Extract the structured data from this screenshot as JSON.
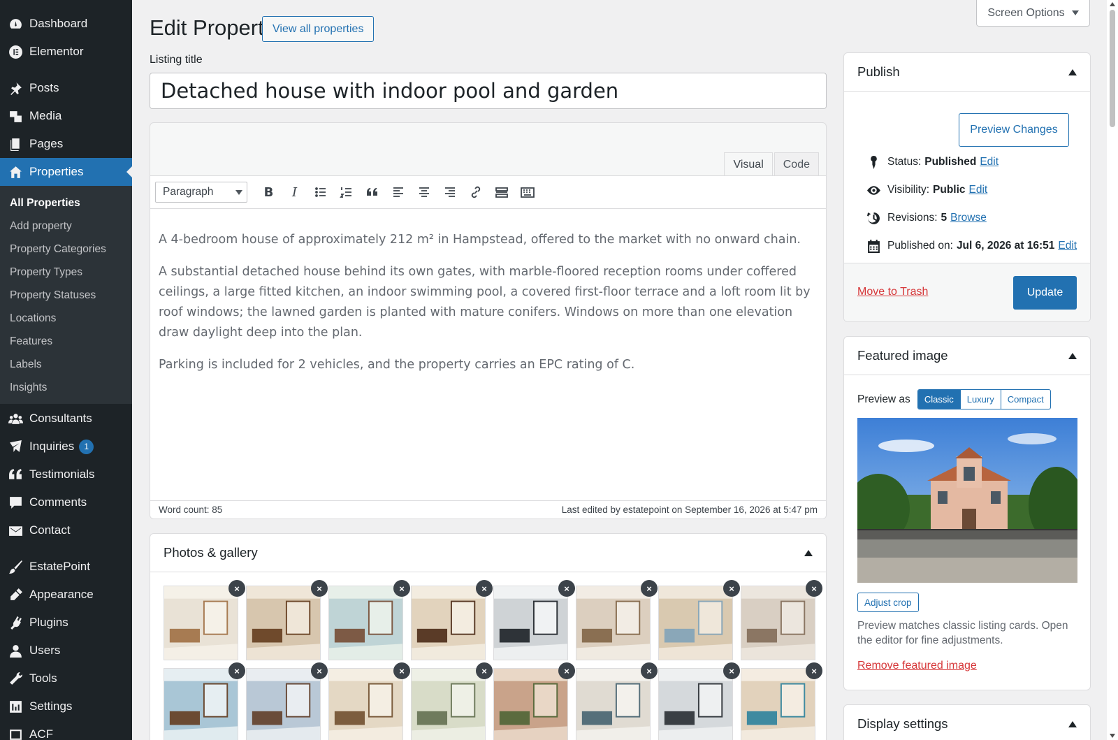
{
  "sidebar": {
    "items_top": [
      {
        "label": "Dashboard",
        "icon": "dashboard-icon"
      },
      {
        "label": "Elementor",
        "icon": "elementor-icon"
      }
    ],
    "items_content": [
      {
        "label": "Posts",
        "icon": "pin-icon"
      },
      {
        "label": "Media",
        "icon": "media-icon"
      },
      {
        "label": "Pages",
        "icon": "pages-icon"
      },
      {
        "label": "Properties",
        "icon": "home-icon"
      }
    ],
    "submenu": [
      "All Properties",
      "Add property",
      "Property Categories",
      "Property Types",
      "Property Statuses",
      "Locations",
      "Features",
      "Labels",
      "Insights"
    ],
    "items_after": [
      {
        "label": "Consultants",
        "icon": "groups-icon"
      },
      {
        "label": "Inquiries",
        "icon": "feedback-icon",
        "badge": "1"
      },
      {
        "label": "Testimonials",
        "icon": "quote-icon"
      },
      {
        "label": "Comments",
        "icon": "comments-icon"
      },
      {
        "label": "Contact",
        "icon": "email-icon"
      }
    ],
    "items_admin": [
      {
        "label": "EstatePoint",
        "icon": "brush-icon"
      },
      {
        "label": "Appearance",
        "icon": "appearance-icon"
      },
      {
        "label": "Plugins",
        "icon": "plugins-icon"
      },
      {
        "label": "Users",
        "icon": "users-icon"
      },
      {
        "label": "Tools",
        "icon": "tools-icon"
      },
      {
        "label": "Settings",
        "icon": "settings-icon"
      },
      {
        "label": "ACF",
        "icon": "acf-icon"
      }
    ]
  },
  "header": {
    "title": "Edit Property",
    "view_all": "View all properties",
    "screen_options": "Screen Options"
  },
  "listing": {
    "label": "Listing title",
    "value": "Detached house with indoor pool and garden"
  },
  "editor": {
    "tabs": [
      "Visual",
      "Code"
    ],
    "format": "Paragraph",
    "paragraphs": [
      "A 4-bedroom house of approximately 212 m² in Hampstead, offered to the market with no onward chain.",
      "A substantial detached house behind its own gates, with marble-floored reception rooms under coffered ceilings, a large fitted kitchen, an indoor swimming pool, a covered first-floor terrace and a loft room lit by roof windows; the lawned garden is planted with mature conifers. Windows on more than one elevation draw daylight deep into the plan.",
      "Parking is included for 2 vehicles, and the property carries an EPC rating of C."
    ],
    "word_count": "Word count: 85",
    "last_edited": "Last edited by estatepoint on September 16, 2026 at 5:47 pm"
  },
  "photos": {
    "title": "Photos & gallery",
    "count": 16
  },
  "publish": {
    "title": "Publish",
    "preview": "Preview Changes",
    "status_label": "Status:",
    "status": "Published",
    "visibility_label": "Visibility:",
    "visibility": "Public",
    "revisions_label": "Revisions:",
    "revisions": "5",
    "browse": "Browse",
    "published_label": "Published on:",
    "published": "Jul 6, 2026 at 16:51",
    "edit": "Edit",
    "trash": "Move to Trash",
    "update": "Update"
  },
  "featured": {
    "title": "Featured image",
    "preview_as": "Preview as",
    "modes": [
      "Classic",
      "Luxury",
      "Compact"
    ],
    "adjust": "Adjust crop",
    "note": "Preview matches classic listing cards. Open the editor for fine adjustments.",
    "remove": "Remove featured image"
  },
  "display": {
    "title": "Display settings"
  },
  "colors": {
    "accent": "#2271b1",
    "sidebar": "#1d2327",
    "danger": "#d63638"
  }
}
